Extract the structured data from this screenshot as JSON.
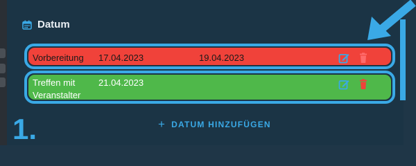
{
  "section": {
    "title": "Datum",
    "icon": "calendar-icon"
  },
  "rows": [
    {
      "label": "Vorbereitung",
      "start": "17.04.2023",
      "end": "19.04.2023",
      "color": "#f0423a",
      "edit_icon": "edit-icon",
      "delete_icon": "trash-icon"
    },
    {
      "label_line1": "Treffen mit",
      "label_line2": "Veranstalter",
      "start": "21.04.2023",
      "color": "#4fb84a",
      "edit_icon": "edit-icon",
      "delete_icon": "trash-icon"
    }
  ],
  "add_button": {
    "label": "DATUM HINZUFÜGEN",
    "icon": "plus-icon"
  },
  "step_label": "1.",
  "colors": {
    "accent": "#3aa9e6",
    "panel": "#1b3445",
    "delete": "#f0423a"
  }
}
